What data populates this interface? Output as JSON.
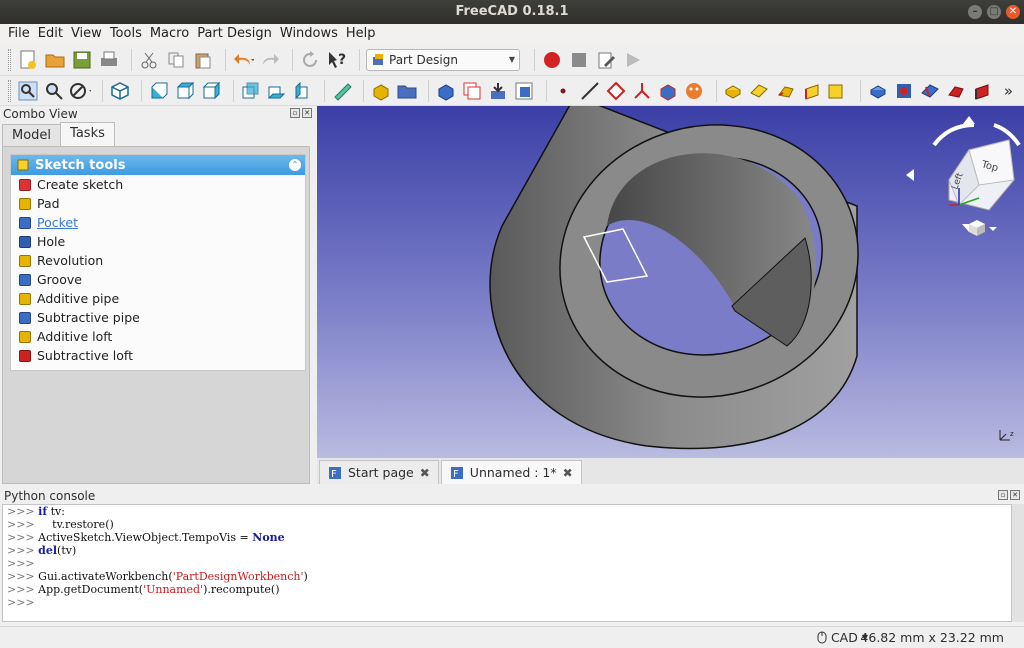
{
  "window": {
    "title": "FreeCAD 0.18.1"
  },
  "menu": [
    "File",
    "Edit",
    "View",
    "Tools",
    "Macro",
    "Part Design",
    "Windows",
    "Help"
  ],
  "toolbar": {
    "workbench": "Part Design"
  },
  "combo": {
    "title": "Combo View",
    "tabs": [
      "Model",
      "Tasks"
    ],
    "active_tab": "Tasks",
    "panel_title": "Sketch tools",
    "tasks": [
      {
        "label": "Create sketch",
        "icon": "sketch-icon",
        "color": "#d33"
      },
      {
        "label": "Pad",
        "icon": "pad-icon",
        "color": "#e6b400"
      },
      {
        "label": "Pocket",
        "icon": "pocket-icon",
        "color": "#3a6ec4"
      },
      {
        "label": "Hole",
        "icon": "hole-icon",
        "color": "#2f5fae"
      },
      {
        "label": "Revolution",
        "icon": "revolution-icon",
        "color": "#e6b400"
      },
      {
        "label": "Groove",
        "icon": "groove-icon",
        "color": "#3a6ec4"
      },
      {
        "label": "Additive pipe",
        "icon": "additive-pipe-icon",
        "color": "#e6b400"
      },
      {
        "label": "Subtractive pipe",
        "icon": "subtractive-pipe-icon",
        "color": "#3a6ec4"
      },
      {
        "label": "Additive loft",
        "icon": "additive-loft-icon",
        "color": "#e6b400"
      },
      {
        "label": "Subtractive loft",
        "icon": "subtractive-loft-icon",
        "color": "#cc2222"
      }
    ]
  },
  "viewtabs": [
    {
      "label": "Start page",
      "active": false
    },
    {
      "label": "Unnamed : 1*",
      "active": true
    }
  ],
  "navcube": {
    "face_top": "Top",
    "face_left": "Left"
  },
  "console": {
    "title": "Python console",
    "lines": [
      {
        "prompt": ">>> ",
        "parts": [
          [
            "kw",
            "if"
          ],
          [
            "",
            " tv:"
          ]
        ]
      },
      {
        "prompt": ">>> ",
        "parts": [
          [
            "",
            "    tv.restore()"
          ]
        ]
      },
      {
        "prompt": ">>> ",
        "parts": [
          [
            "",
            "ActiveSketch.ViewObject.TempoVis = "
          ],
          [
            "kw",
            "None"
          ]
        ]
      },
      {
        "prompt": ">>> ",
        "parts": [
          [
            "kw",
            "del"
          ],
          [
            "",
            "(tv)"
          ]
        ]
      },
      {
        "prompt": ">>> ",
        "parts": []
      },
      {
        "prompt": ">>> ",
        "parts": [
          [
            "",
            "Gui.activateWorkbench("
          ],
          [
            "str",
            "'PartDesignWorkbench'"
          ],
          [
            "",
            ")"
          ]
        ]
      },
      {
        "prompt": ">>> ",
        "parts": [
          [
            "",
            "App.getDocument("
          ],
          [
            "str",
            "'Unnamed'"
          ],
          [
            "",
            ").recompute()"
          ]
        ]
      },
      {
        "prompt": ">>> ",
        "parts": []
      }
    ]
  },
  "status": {
    "nav_style": "CAD",
    "dimensions": "46.82 mm x 23.22 mm"
  }
}
